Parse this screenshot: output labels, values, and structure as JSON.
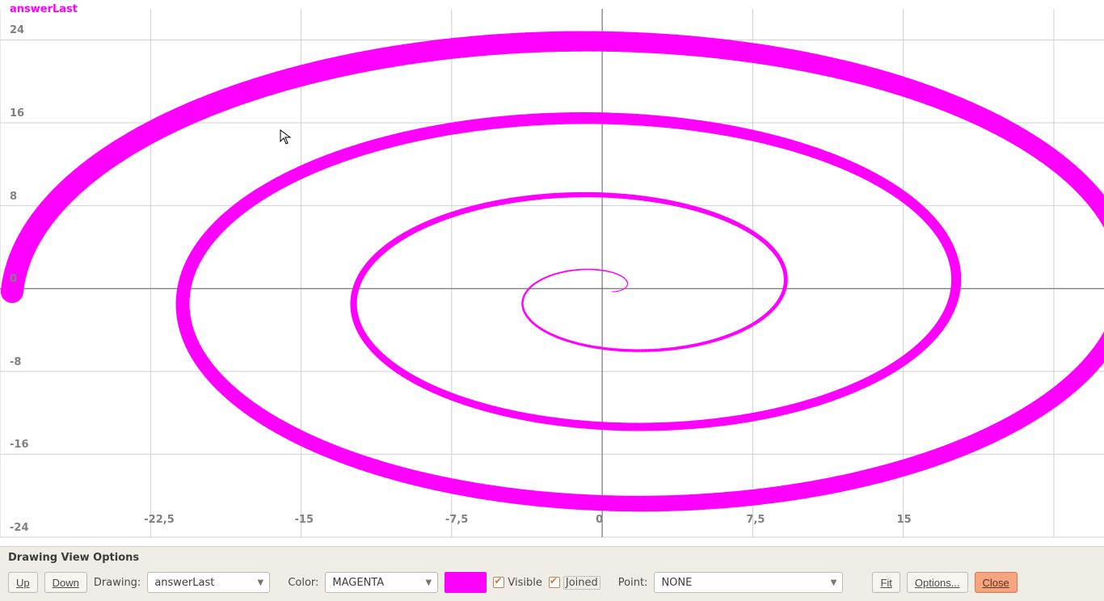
{
  "chart_data": {
    "type": "line",
    "title": "",
    "xlabel": "",
    "ylabel": "",
    "xlim": [
      -30,
      25
    ],
    "ylim": [
      -24,
      27
    ],
    "x_ticks": [
      -22.5,
      -15,
      -7.5,
      0,
      7.5,
      15
    ],
    "y_ticks": [
      24,
      16,
      8,
      0,
      -8,
      -16,
      -24
    ],
    "series": [
      {
        "name": "answerLast",
        "color": "#ff00ff",
        "kind": "spiral",
        "description": "Archimedean-like spiral centered near origin, line width increasing with radius",
        "center": [
          0.5,
          -0.3
        ],
        "turns": 3.5,
        "r_start": 0,
        "r_end": 26,
        "aspect_ratio_xy": 1.15,
        "stroke_width_start": 1,
        "stroke_width_end": 28
      }
    ]
  },
  "plot": {
    "series_label": "answerLast",
    "series_color": "#ff00ff"
  },
  "panel": {
    "title": "Drawing View Options",
    "up_label": "Up",
    "down_label": "Down",
    "drawing_label": "Drawing:",
    "drawing_value": "answerLast",
    "color_label": "Color:",
    "color_value": "MAGENTA",
    "color_swatch": "#ff00ff",
    "visible_label": "Visible",
    "visible_checked": true,
    "joined_label": "Joined",
    "joined_checked": true,
    "joined_focused": true,
    "point_label": "Point:",
    "point_value": "NONE",
    "fit_label": "Fit",
    "options_label": "Options...",
    "close_label": "Close"
  }
}
